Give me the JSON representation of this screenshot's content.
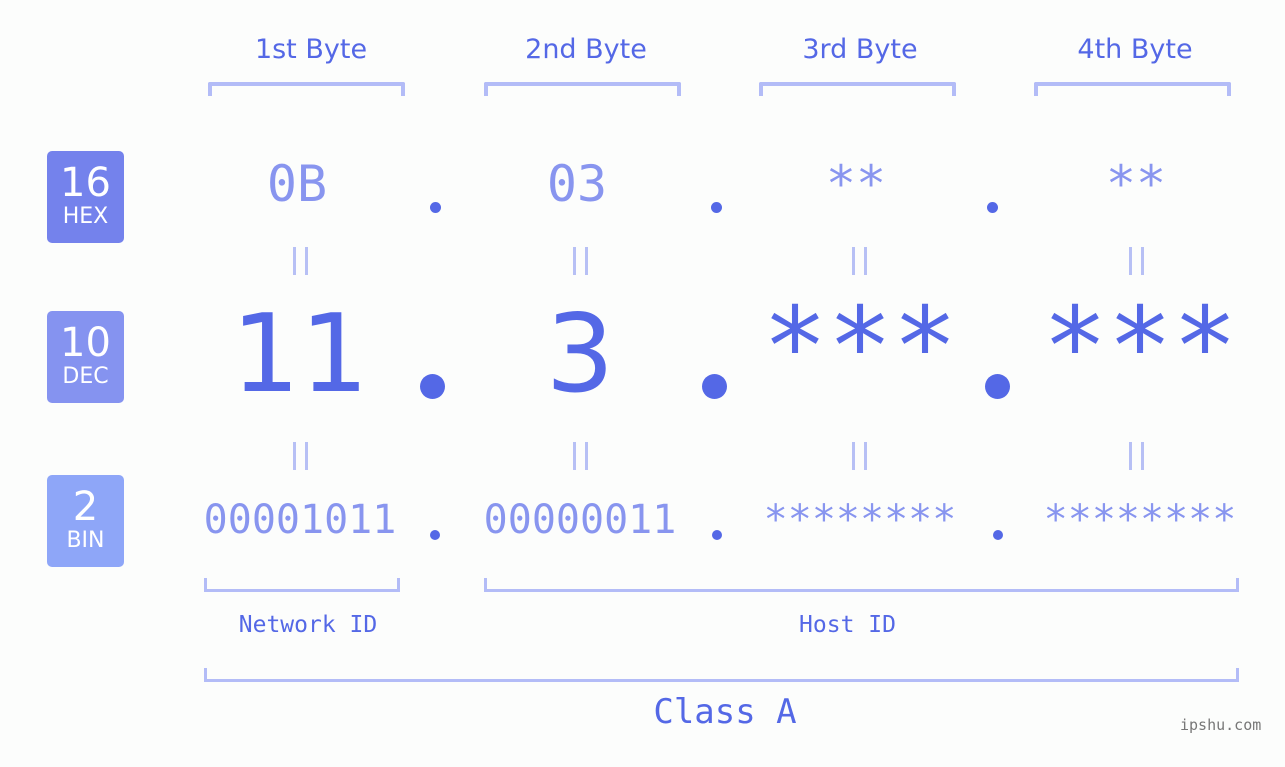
{
  "headers": [
    "1st Byte",
    "2nd Byte",
    "3rd Byte",
    "4th Byte"
  ],
  "badges": {
    "hex": {
      "num": "16",
      "label": "HEX",
      "color": "#7482ec"
    },
    "dec": {
      "num": "10",
      "label": "DEC",
      "color": "#8593f0"
    },
    "bin": {
      "num": "2",
      "label": "BIN",
      "color": "#8ea6f8"
    }
  },
  "hex": [
    "0B",
    "03",
    "**",
    "**"
  ],
  "dec": [
    "11",
    "3",
    "***",
    "***"
  ],
  "bin": [
    "00001011",
    "00000011",
    "********",
    "********"
  ],
  "labels": {
    "network": "Network ID",
    "host": "Host ID",
    "class": "Class A"
  },
  "watermark": "ipshu.com",
  "colors": {
    "accent": "#5468e6",
    "light": "#8895ef",
    "bracket": "#b3bcf7"
  }
}
